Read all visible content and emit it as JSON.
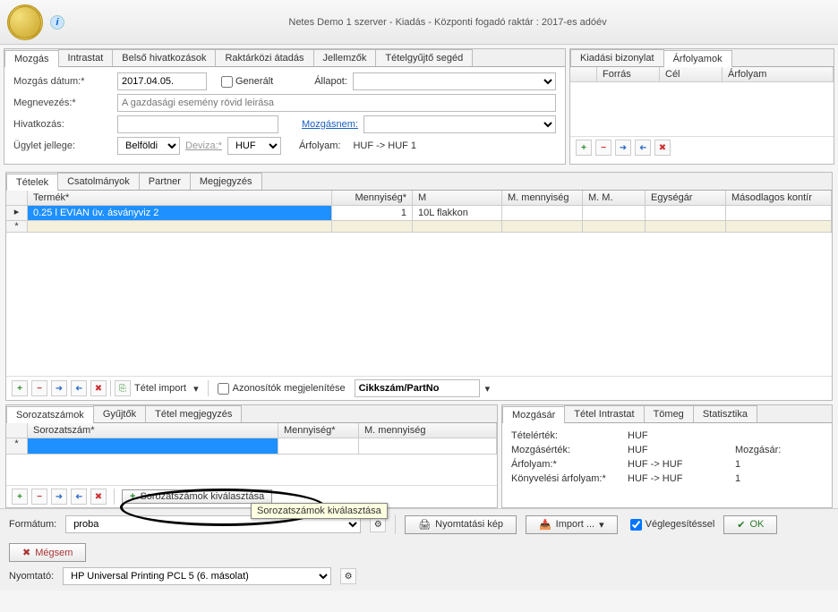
{
  "title": "Netes Demo 1 szerver - Kiadás - Központi fogadó raktár : 2017-es adóév",
  "main_tabs": [
    "Mozgás",
    "Intrastat",
    "Belső hivatkozások",
    "Raktárközi átadás",
    "Jellemzők",
    "Tételgyűjtő segéd"
  ],
  "right_tabs": [
    "Kiadási bizonylat",
    "Árfolyamok"
  ],
  "right_grid_cols": [
    "Forrás",
    "Cél",
    "Árfolyam"
  ],
  "form": {
    "date_label": "Mozgás dátum:*",
    "date_value": "2017.04.05.",
    "gen_label": "Generált",
    "status_label": "Állapot:",
    "name_label": "Megnevezés:*",
    "name_placeholder": "A gazdasági esemény rövid leirása",
    "ref_label": "Hivatkozás:",
    "movtype_link": "Mozgásnem:",
    "deal_label": "Ügylet jellege:",
    "deal_value": "Belföldi",
    "currency_link": "Deviza:*",
    "currency_value": "HUF",
    "rate_label": "Árfolyam:",
    "rate_text": "HUF  ->  HUF   1"
  },
  "items_tabs": [
    "Tételek",
    "Csatolmányok",
    "Partner",
    "Megjegyzés"
  ],
  "items_cols": [
    "Termék*",
    "Mennyiség*",
    "M",
    "M. mennyiség",
    "M. M.",
    "Egységár",
    "Másodlagos kontír"
  ],
  "item_row": {
    "product": "0.25 l EVIAN üv. ásványviz 2",
    "qty": "1",
    "m": "10L flakkon"
  },
  "mid_toolbar": {
    "import_label": "Tétel import",
    "ids_label": "Azonosítók megjelenítése",
    "filter_value": "Cikkszám/PartNo"
  },
  "serial_tabs": [
    "Sorozatszámok",
    "Gyűjtők",
    "Tétel megjegyzés"
  ],
  "serial_cols": [
    "Sorozatszám*",
    "Mennyiség*",
    "M. mennyiség"
  ],
  "serial_button": "Sorozatszámok kiválasztása",
  "serial_tooltip": "Sorozatszámok kiválasztása",
  "right_detail_tabs": [
    "Mozgásár",
    "Tétel Intrastat",
    "Tömeg",
    "Statisztika"
  ],
  "details": {
    "l1": "Tételérték:",
    "v1": "HUF",
    "l2": "Mozgásérték:",
    "v2": "HUF",
    "r2": "Mozgásár:",
    "l3": "Árfolyam:*",
    "v3": "HUF  ->  HUF",
    "n3": "1",
    "l4": "Könyvelési árfolyam:*",
    "v4": "HUF  ->  HUF",
    "n4": "1"
  },
  "footer": {
    "format_label": "Formátum:",
    "format_value": "proba",
    "printer_label": "Nyomtató:",
    "printer_value": "HP Universal Printing PCL 5 (6. másolat)",
    "preview": "Nyomtatási kép",
    "import": "Import ...",
    "finalize": "Véglegesítéssel",
    "ok": "OK",
    "cancel": "Mégsem"
  }
}
